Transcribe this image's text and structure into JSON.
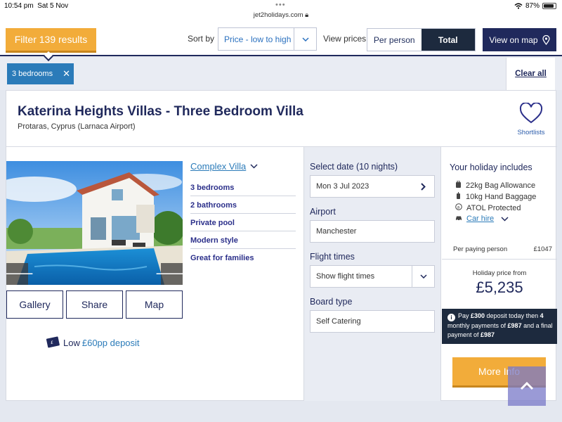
{
  "status_bar": {
    "time": "10:54 pm",
    "date": "Sat 5 Nov",
    "url": "jet2holidays.com",
    "battery": "87%"
  },
  "filter_bar": {
    "filter_button": "Filter 139 results",
    "sort_label": "Sort by",
    "sort_value": "Price - low to high",
    "view_prices_label": "View prices",
    "view_options": [
      "Per person",
      "Total"
    ],
    "view_selected": "Total",
    "map_button": "View on map"
  },
  "chips": {
    "items": [
      "3 bedrooms"
    ],
    "clear_all": "Clear all"
  },
  "property": {
    "title": "Katerina Heights Villas - Three Bedroom Villa",
    "location": "Protaras, Cyprus (Larnaca Airport)",
    "shortlist_label": "Shortlists",
    "type_link": "Complex Villa",
    "features": [
      "3 bedrooms",
      "2 bathrooms",
      "Private pool",
      "Modern style",
      "Great for families"
    ],
    "gallery_buttons": [
      "Gallery",
      "Share",
      "Map"
    ],
    "deposit_prefix": "Low",
    "deposit_link": "£60pp deposit"
  },
  "booking": {
    "date_label": "Select date (10 nights)",
    "date_value": "Mon 3 Jul 2023",
    "airport_label": "Airport",
    "airport_value": "Manchester",
    "flight_label": "Flight times",
    "flight_value": "Show flight times",
    "board_label": "Board type",
    "board_value": "Self Catering"
  },
  "includes": {
    "title": "Your holiday includes",
    "items": [
      {
        "icon": "luggage-icon",
        "text": "22kg Bag Allowance"
      },
      {
        "icon": "hand-baggage-icon",
        "text": "10kg Hand Baggage"
      },
      {
        "icon": "atol-icon",
        "text": "ATOL Protected"
      },
      {
        "icon": "car-icon",
        "text": "Car hire"
      }
    ],
    "per_person_label": "Per paying person",
    "per_person_value": "£1047"
  },
  "pricing": {
    "from_label": "Holiday price from",
    "price": "£5,235",
    "finance_parts": [
      "Pay ",
      "£300",
      " deposit today then ",
      "4",
      " monthly payments of ",
      "£987",
      " and a final payment of ",
      "£987"
    ],
    "more_info": "More Info"
  },
  "colors": {
    "navy": "#20295c",
    "orange": "#f2ac3a",
    "blue_chip": "#2b7bb9",
    "dark_toggle": "#1d2a3e"
  }
}
